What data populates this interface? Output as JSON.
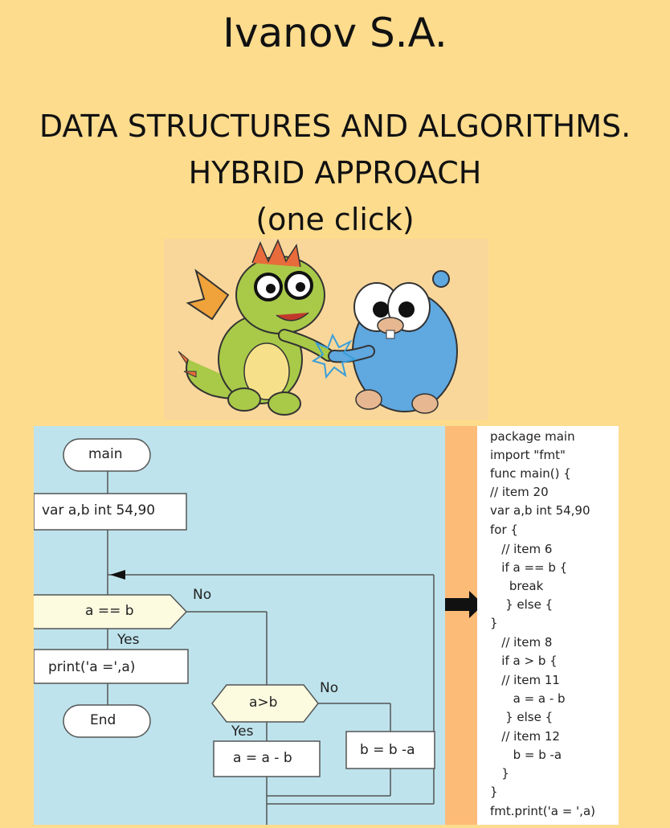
{
  "cover": {
    "author": "Ivanov S.A.",
    "title_line1": "DATA STRUCTURES AND ALGORITHMS.",
    "title_line2": "HYBRID APPROACH",
    "title_line3": "(one click)"
  },
  "flowchart": {
    "start": "main",
    "declare": "var a,b int 54,90",
    "condition1": "a == b",
    "no1": "No",
    "yes1": "Yes",
    "print": "print('a =',a)",
    "end": "End",
    "condition2": "a>b",
    "no2": "No",
    "yes2": "Yes",
    "assign_a": "a = a - b",
    "assign_b": "b = b -a"
  },
  "code": [
    "package main",
    "import \"fmt\"",
    "func main() {",
    "// item 20",
    "var a,b int 54,90",
    "for {",
    "   // item 6",
    "   if a == b {",
    "     break",
    "    } else {",
    "}",
    "   // item 8",
    "   if a > b {",
    "   // item 11",
    "      a = a - b",
    "    } else {",
    "   // item 12",
    "      b = b -a",
    "   }",
    "}",
    "fmt.print('a = ',a)"
  ],
  "colors": {
    "background": "#fddc8e",
    "flow_bg": "#bee3ec",
    "strip": "#fdbb78",
    "dragon": "#a9c948",
    "gopher": "#5fa8e0"
  }
}
